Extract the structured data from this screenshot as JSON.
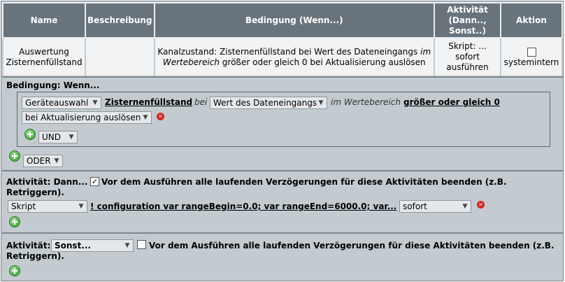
{
  "table": {
    "headers": {
      "name": "Name",
      "description": "Beschreibung",
      "condition": "Bedingung (Wenn...)",
      "activity": "Aktivität (Dann.., Sonst..)",
      "action": "Aktion"
    },
    "row": {
      "name": "Auswertung Zisternenfüllstand",
      "description": "",
      "condition_part1": "Kanalzustand: Zisternenfüllstand bei Wert des Dateneingangs",
      "condition_italic": "im Wertebereich",
      "condition_part2": "größer oder gleich 0 bei Aktualisierung auslösen",
      "activity": "Skript: ... sofort ausführen",
      "action_label": "systemintern",
      "action_checked": false
    }
  },
  "condition": {
    "heading": "Bedingung: Wenn...",
    "device_select": "Geräteauswahl",
    "device_name": "Zisternenfüllstand",
    "bei": "bei",
    "value_select": "Wert des Dateneingangs",
    "range_text": "im Wertebereich",
    "range_value": "größer oder gleich 0",
    "trigger_select": "bei Aktualisierung auslösen",
    "and_select": "UND",
    "or_select": "ODER"
  },
  "then": {
    "heading": "Aktivität: Dann...",
    "stop_delays_checked": true,
    "stop_delays_label": "Vor dem Ausführen alle laufenden Verzögerungen für diese Aktivitäten beenden (z.B.",
    "stop_delays_label2": "Retriggern).",
    "type_select": "Skript",
    "script_link": "! configuration var rangeBegin=0.0; var rangeEnd=6000.0; var...",
    "timing_select": "sofort"
  },
  "else": {
    "heading": "Aktivität:",
    "type_select": "Sonst...",
    "stop_delays_checked": false,
    "stop_delays_label": "Vor dem Ausführen alle laufenden Verzögerungen für diese Aktivitäten beenden (z.B.",
    "stop_delays_label2": "Retriggern)."
  },
  "colors": {
    "header_bg": "#68737b",
    "panel_bg": "#c3cbd0",
    "cell_bg": "#f1f3f4"
  },
  "icons": {
    "add": "plus-circle-icon",
    "delete": "delete-x-icon",
    "dropdown": "chevron-down-icon"
  }
}
